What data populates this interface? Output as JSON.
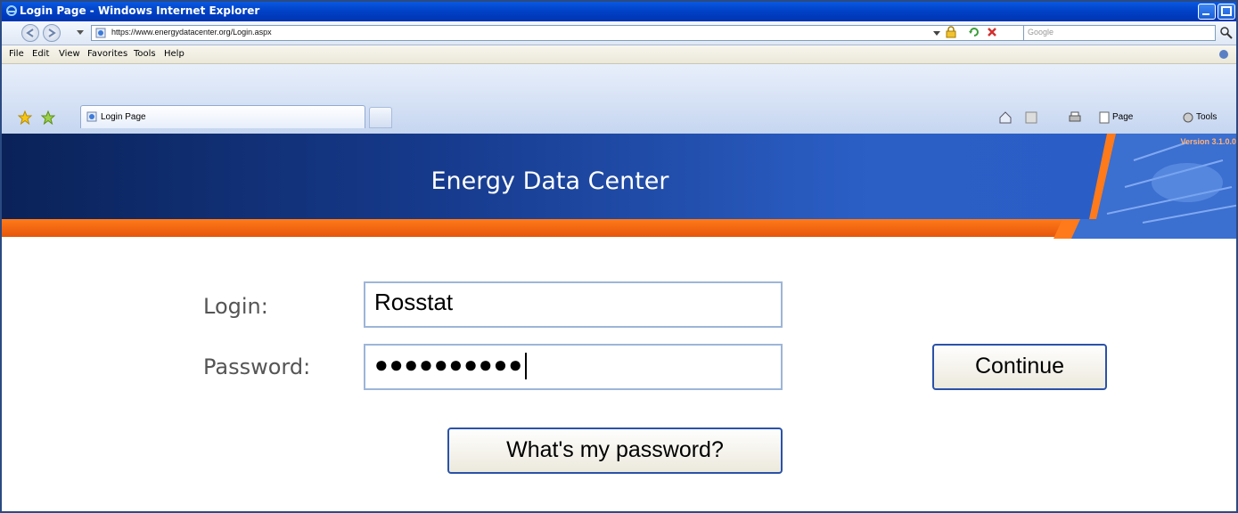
{
  "window": {
    "title": "Login Page - Windows Internet Explorer"
  },
  "address_bar": {
    "url": "https://www.energydatacenter.org/Login.aspx",
    "search_placeholder": "Google"
  },
  "menu": {
    "items": [
      "File",
      "Edit",
      "View",
      "Favorites",
      "Tools",
      "Help"
    ]
  },
  "tabs": {
    "active_label": "Login Page"
  },
  "command_bar": {
    "page_label": "Page",
    "tools_label": "Tools"
  },
  "banner": {
    "title": "Energy Data Center",
    "version": "Version 3.1.0.0"
  },
  "login_form": {
    "login_label": "Login:",
    "login_value": "Rosstat",
    "password_label": "Password:",
    "password_value": "●●●●●●●●●●",
    "continue_label": "Continue",
    "forgot_label": "What's my password?"
  },
  "colors": {
    "banner_blue": "#163a8c",
    "banner_orange": "#ff7a1a",
    "button_border": "#2a52a8"
  }
}
